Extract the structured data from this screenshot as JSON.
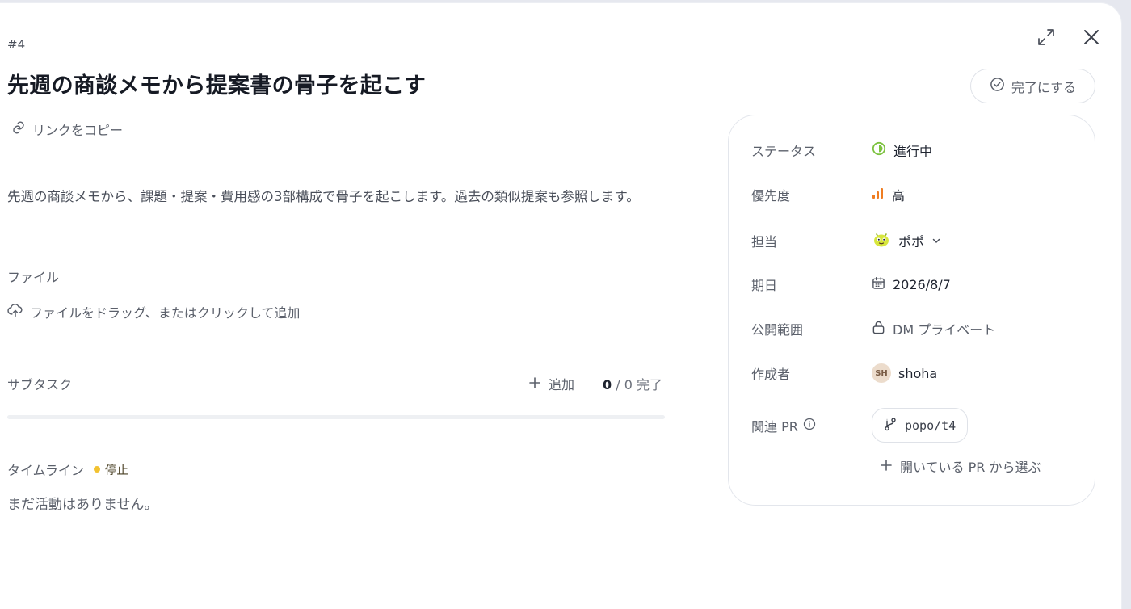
{
  "task": {
    "id": "#4",
    "title": "先週の商談メモから提案書の骨子を起こす",
    "copy_link_label": "リンクをコピー",
    "description": "先週の商談メモから、課題・提案・費用感の3部構成で骨子を起こします。過去の類似提案も参照します。"
  },
  "files": {
    "label": "ファイル",
    "upload_label": "ファイルをドラッグ、またはクリックして追加"
  },
  "subtasks": {
    "label": "サブタスク",
    "add_label": "追加",
    "done": "0",
    "separator": "/",
    "total_suffix": "0 完了",
    "progress": 0
  },
  "timeline": {
    "label": "タイムライン",
    "state": "停止",
    "empty_text": "まだ活動はありません。"
  },
  "actions": {
    "complete_label": "完了にする"
  },
  "properties": {
    "status": {
      "label": "ステータス",
      "value": "進行中"
    },
    "priority": {
      "label": "優先度",
      "value": "高"
    },
    "assignee": {
      "label": "担当",
      "value": "ポポ"
    },
    "due": {
      "label": "期日",
      "value": "2026/8/7"
    },
    "visibility": {
      "label": "公開範囲",
      "value": "DM プライベート"
    },
    "creator": {
      "label": "作成者",
      "initials": "SH",
      "value": "shoha"
    },
    "related_pr": {
      "label": "関連 PR",
      "chip": "popo/t4",
      "add_label": "開いている PR から選ぶ"
    }
  },
  "colors": {
    "status": "#7cc23f",
    "priority": "#ef7d22",
    "timeline_dot": "#f2c230"
  },
  "icons": {
    "link": "link-icon",
    "upload": "cloud-upload-icon",
    "plus": "plus-icon",
    "expand": "expand-icon",
    "close": "close-icon",
    "check_circle": "check-circle-icon",
    "calendar": "calendar-icon",
    "lock": "lock-icon",
    "branch": "git-branch-icon",
    "info": "info-icon",
    "chevron": "chevron-down-icon"
  }
}
